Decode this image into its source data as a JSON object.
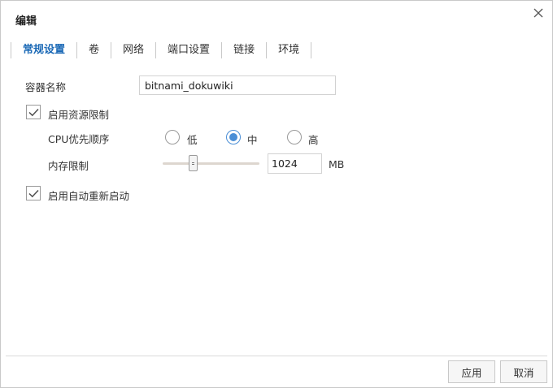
{
  "dialog": {
    "title": "编辑"
  },
  "tabs": [
    {
      "label": "常规设置",
      "active": true
    },
    {
      "label": "卷"
    },
    {
      "label": "网络"
    },
    {
      "label": "端口设置"
    },
    {
      "label": "链接"
    },
    {
      "label": "环境"
    }
  ],
  "general": {
    "container_name_label": "容器名称",
    "container_name_value": "bitnami_dokuwiki",
    "resource_limit_label": "启用资源限制",
    "resource_limit_checked": true,
    "cpu_priority_label": "CPU优先顺序",
    "cpu_options": [
      "低",
      "中",
      "高"
    ],
    "cpu_selected": "中",
    "memory_limit_label": "内存限制",
    "memory_value": "1024",
    "memory_unit": "MB",
    "memory_slider_fraction": 0.3,
    "auto_restart_label": "启用自动重新启动",
    "auto_restart_checked": true
  },
  "footer": {
    "apply_label": "应用",
    "cancel_label": "取消"
  },
  "colors": {
    "accent": "#1b69b6",
    "radio": "#4a8ed6"
  }
}
